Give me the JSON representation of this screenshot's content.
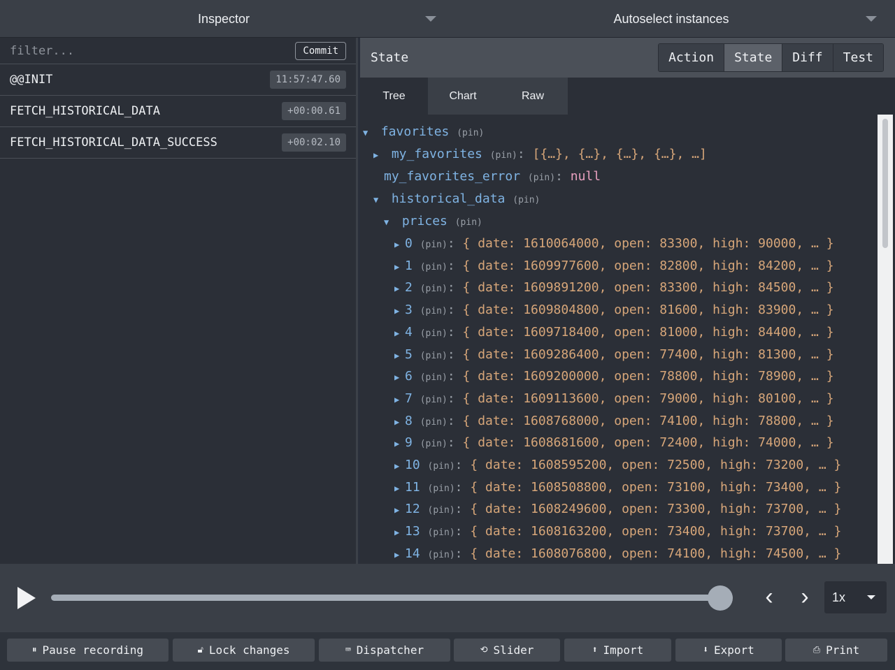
{
  "topbar": {
    "monitor": "Inspector",
    "instances": "Autoselect instances"
  },
  "actions_panel": {
    "filter_placeholder": "filter...",
    "commit_label": "Commit",
    "actions": [
      {
        "name": "@@INIT",
        "time": "11:57:47.60"
      },
      {
        "name": "FETCH_HISTORICAL_DATA",
        "time": "+00:00.61"
      },
      {
        "name": "FETCH_HISTORICAL_DATA_SUCCESS",
        "time": "+00:02.10"
      }
    ]
  },
  "state_panel": {
    "title": "State",
    "tabs": [
      "Action",
      "State",
      "Diff",
      "Test"
    ],
    "active_tab": "State",
    "subtabs": [
      "Tree",
      "Chart",
      "Raw"
    ],
    "active_subtab": "Tree",
    "pin": "(pin)",
    "tree": {
      "favorites": "favorites",
      "my_favorites": "my_favorites",
      "my_favorites_value": "[{…}, {…}, {…}, {…}, …]",
      "my_favorites_error": "my_favorites_error",
      "my_favorites_error_value": "null",
      "historical_data": "historical_data",
      "prices": "prices",
      "price_rows": [
        {
          "key": "0",
          "value": "{ date: 1610064000, open: 83300, high: 90000, … }"
        },
        {
          "key": "1",
          "value": "{ date: 1609977600, open: 82800, high: 84200, … }"
        },
        {
          "key": "2",
          "value": "{ date: 1609891200, open: 83300, high: 84500, … }"
        },
        {
          "key": "3",
          "value": "{ date: 1609804800, open: 81600, high: 83900, … }"
        },
        {
          "key": "4",
          "value": "{ date: 1609718400, open: 81000, high: 84400, … }"
        },
        {
          "key": "5",
          "value": "{ date: 1609286400, open: 77400, high: 81300, … }"
        },
        {
          "key": "6",
          "value": "{ date: 1609200000, open: 78800, high: 78900, … }"
        },
        {
          "key": "7",
          "value": "{ date: 1609113600, open: 79000, high: 80100, … }"
        },
        {
          "key": "8",
          "value": "{ date: 1608768000, open: 74100, high: 78800, … }"
        },
        {
          "key": "9",
          "value": "{ date: 1608681600, open: 72400, high: 74000, … }"
        },
        {
          "key": "10",
          "value": "{ date: 1608595200, open: 72500, high: 73200, … }"
        },
        {
          "key": "11",
          "value": "{ date: 1608508800, open: 73100, high: 73400, … }"
        },
        {
          "key": "12",
          "value": "{ date: 1608249600, open: 73300, high: 73700, … }"
        },
        {
          "key": "13",
          "value": "{ date: 1608163200, open: 73400, high: 73700, … }"
        },
        {
          "key": "14",
          "value": "{ date: 1608076800, open: 74100, high: 74500, … }"
        }
      ]
    }
  },
  "slider": {
    "position_fraction": 1.0,
    "speed": "1x"
  },
  "bottom_buttons": [
    {
      "label": "Pause recording",
      "icon": "pause-icon"
    },
    {
      "label": "Lock changes",
      "icon": "lock-icon"
    },
    {
      "label": "Dispatcher",
      "icon": "keyboard-icon"
    },
    {
      "label": "Slider",
      "icon": "history-icon"
    },
    {
      "label": "Import",
      "icon": "upload-icon"
    },
    {
      "label": "Export",
      "icon": "download-icon"
    },
    {
      "label": "Print",
      "icon": "print-icon"
    }
  ]
}
